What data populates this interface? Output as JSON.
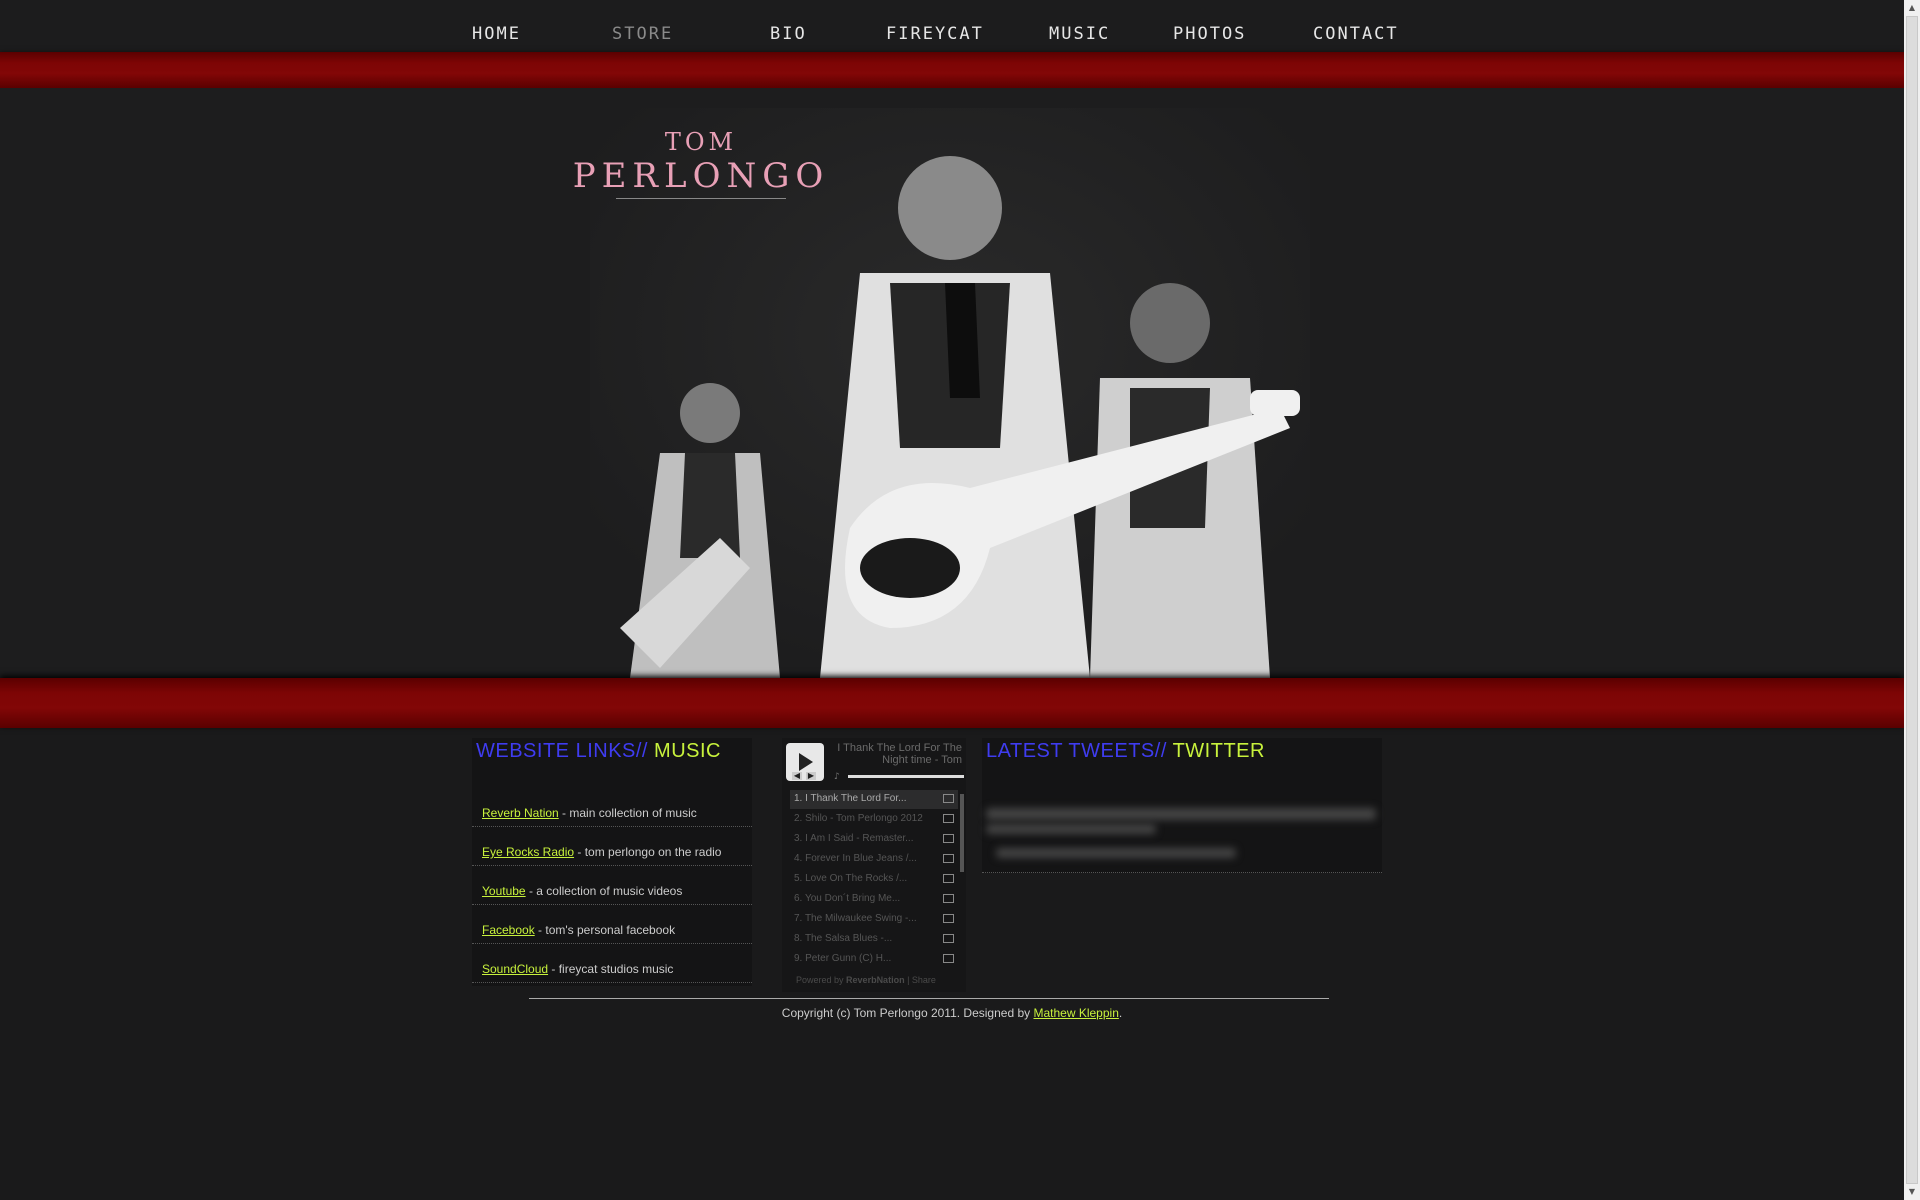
{
  "nav": {
    "items": [
      {
        "label": "HOME"
      },
      {
        "label": "STORE"
      },
      {
        "label": "BIO"
      },
      {
        "label": "FIREYCAT"
      },
      {
        "label": "MUSIC"
      },
      {
        "label": "PHOTOS"
      },
      {
        "label": "CONTACT"
      }
    ]
  },
  "hero": {
    "logo_top": "TOM",
    "logo_bottom": "PERLONGO"
  },
  "links_panel": {
    "title_a": "WEBSITE LINKS//",
    "title_b": "MUSIC",
    "rows": [
      {
        "link": "Reverb Nation",
        "desc": " - main collection of music"
      },
      {
        "link": "Eye Rocks Radio",
        "desc": " - tom perlongo on the radio"
      },
      {
        "link": "Youtube",
        "desc": " - a collection of music videos"
      },
      {
        "link": "Facebook",
        "desc": " - tom's personal facebook"
      },
      {
        "link": "SoundCloud",
        "desc": " - fireycat studios music"
      }
    ]
  },
  "player": {
    "now_playing": "I Thank The Lord For The Night time - Tom",
    "tracks": [
      "1. I Thank The Lord For...",
      "2. Shilo - Tom Perlongo 2012",
      "3. I Am I Said - Remaster...",
      "4. Forever In Blue Jeans /...",
      "5. Love On The Rocks /...",
      "6. You Don´t Bring Me...",
      "7. The Milwaukee Swing -...",
      "8. The Salsa Blues -...",
      "9. Peter Gunn (C) H..."
    ],
    "powered_by": "Powered by",
    "powered_brand": "ReverbNation",
    "share": "Share"
  },
  "tweets_panel": {
    "title_a": "LATEST TWEETS//",
    "title_b": "TWITTER"
  },
  "footer": {
    "text": "Copyright (c) Tom Perlongo 2011. Designed by ",
    "designer": "Mathew Kleppin",
    "end": "."
  },
  "colors": {
    "accent_blue": "#3f3cf0",
    "accent_green": "#c8f23c",
    "band_red": "#7d0505"
  }
}
